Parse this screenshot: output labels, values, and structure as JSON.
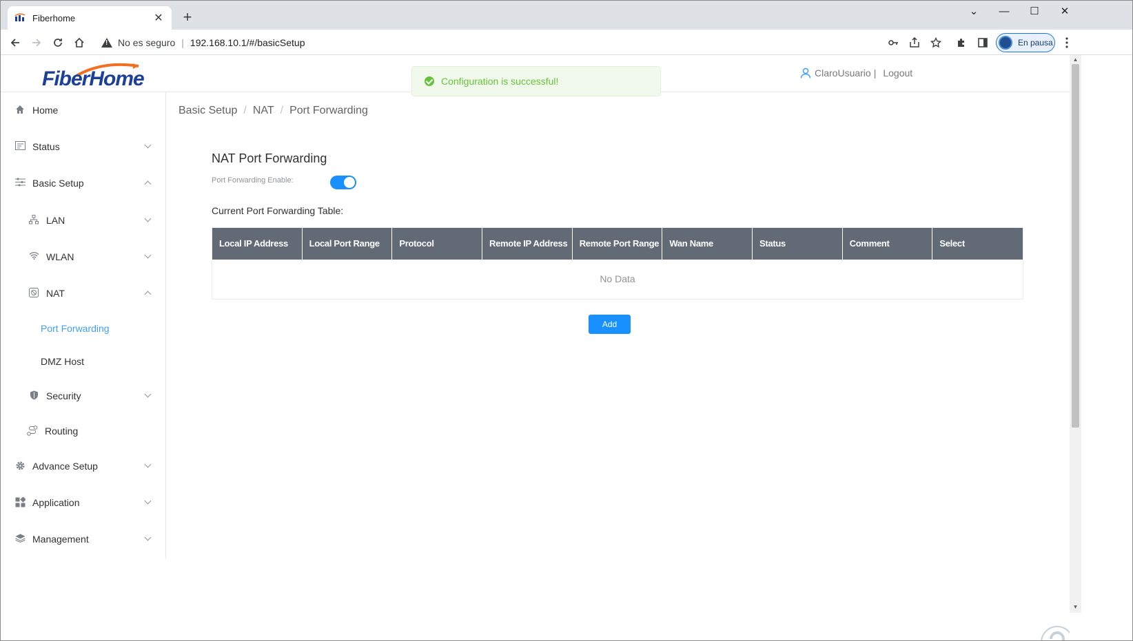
{
  "browser": {
    "tab_title": "Fiberhome",
    "tab_close": "✕",
    "new_tab": "+",
    "security_label": "No es seguro",
    "url_separator": "|",
    "url": "192.168.10.1/#/basicSetup",
    "profile_label": "En pausa",
    "win_min": "⌄",
    "win_minimize": "—",
    "win_maximize": "☐",
    "win_close": "✕"
  },
  "header": {
    "logo_text": "FiberHome",
    "toast_message": "Configuration is successful!",
    "username": "ClaroUsuario",
    "user_sep": "|",
    "logout_label": "Logout"
  },
  "sidebar": {
    "items": [
      {
        "label": "Home",
        "icon": "home-icon"
      },
      {
        "label": "Status",
        "icon": "status-icon"
      },
      {
        "label": "Basic Setup",
        "icon": "basic-setup-icon"
      },
      {
        "label": "LAN",
        "icon": "lan-icon"
      },
      {
        "label": "WLAN",
        "icon": "wifi-icon"
      },
      {
        "label": "NAT",
        "icon": "nat-icon"
      },
      {
        "label": "Port Forwarding"
      },
      {
        "label": "DMZ Host"
      },
      {
        "label": "Security",
        "icon": "shield-icon"
      },
      {
        "label": "Routing",
        "icon": "routing-icon"
      },
      {
        "label": "Advance Setup",
        "icon": "gear-icon"
      },
      {
        "label": "Application",
        "icon": "apps-icon"
      },
      {
        "label": "Management",
        "icon": "layers-icon"
      }
    ]
  },
  "breadcrumb": {
    "items": [
      "Basic Setup",
      "NAT",
      "Port Forwarding"
    ],
    "separator": "/"
  },
  "content": {
    "section_title": "NAT Port Forwarding",
    "enable_label": "Port Forwarding Enable:",
    "enable_on": true,
    "table_caption": "Current Port Forwarding Table:",
    "columns": [
      "Local IP Address",
      "Local Port Range",
      "Protocol",
      "Remote IP Address",
      "Remote Port Range",
      "Wan Name",
      "Status",
      "Comment",
      "Select"
    ],
    "empty_text": "No Data",
    "add_label": "Add"
  },
  "colors": {
    "primary": "#1890ff",
    "table_header": "#616a75",
    "success": "#67c23a",
    "logo_blue": "#1b3f9a",
    "logo_orange": "#f26f21"
  }
}
